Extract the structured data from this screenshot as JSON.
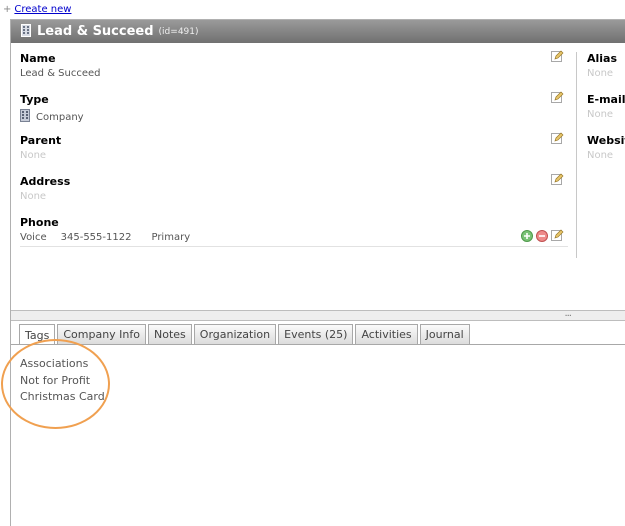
{
  "top": {
    "plus": "+",
    "create_new": "Create new"
  },
  "header": {
    "title": "Lead & Succeed",
    "id_text": "(id=491)"
  },
  "fields": {
    "name": {
      "label": "Name",
      "value": "Lead & Succeed"
    },
    "type": {
      "label": "Type",
      "value": "Company"
    },
    "parent": {
      "label": "Parent",
      "value": "None"
    },
    "address": {
      "label": "Address",
      "value": "None"
    },
    "phone": {
      "label": "Phone",
      "kind": "Voice",
      "number": "345-555-1122",
      "rank": "Primary"
    }
  },
  "right_fields": {
    "alias": {
      "label": "Alias",
      "value": "None"
    },
    "email": {
      "label": "E-mail",
      "value": "None"
    },
    "website": {
      "label": "Website",
      "value": "None"
    }
  },
  "splitter": {
    "grip": "..."
  },
  "tabs": [
    "Tags",
    "Company Info",
    "Notes",
    "Organization",
    "Events (25)",
    "Activities",
    "Journal"
  ],
  "tags": [
    "Associations",
    "Not for Profit",
    "Christmas Card"
  ],
  "icons": {
    "building": "building-icon",
    "edit": "pencil-icon",
    "add": "plus-circle-icon",
    "remove": "minus-circle-icon"
  },
  "colors": {
    "titlebar": "#808080",
    "highlight": "#f0a050",
    "link": "#0000cc",
    "none_text": "#c8c8c8"
  }
}
